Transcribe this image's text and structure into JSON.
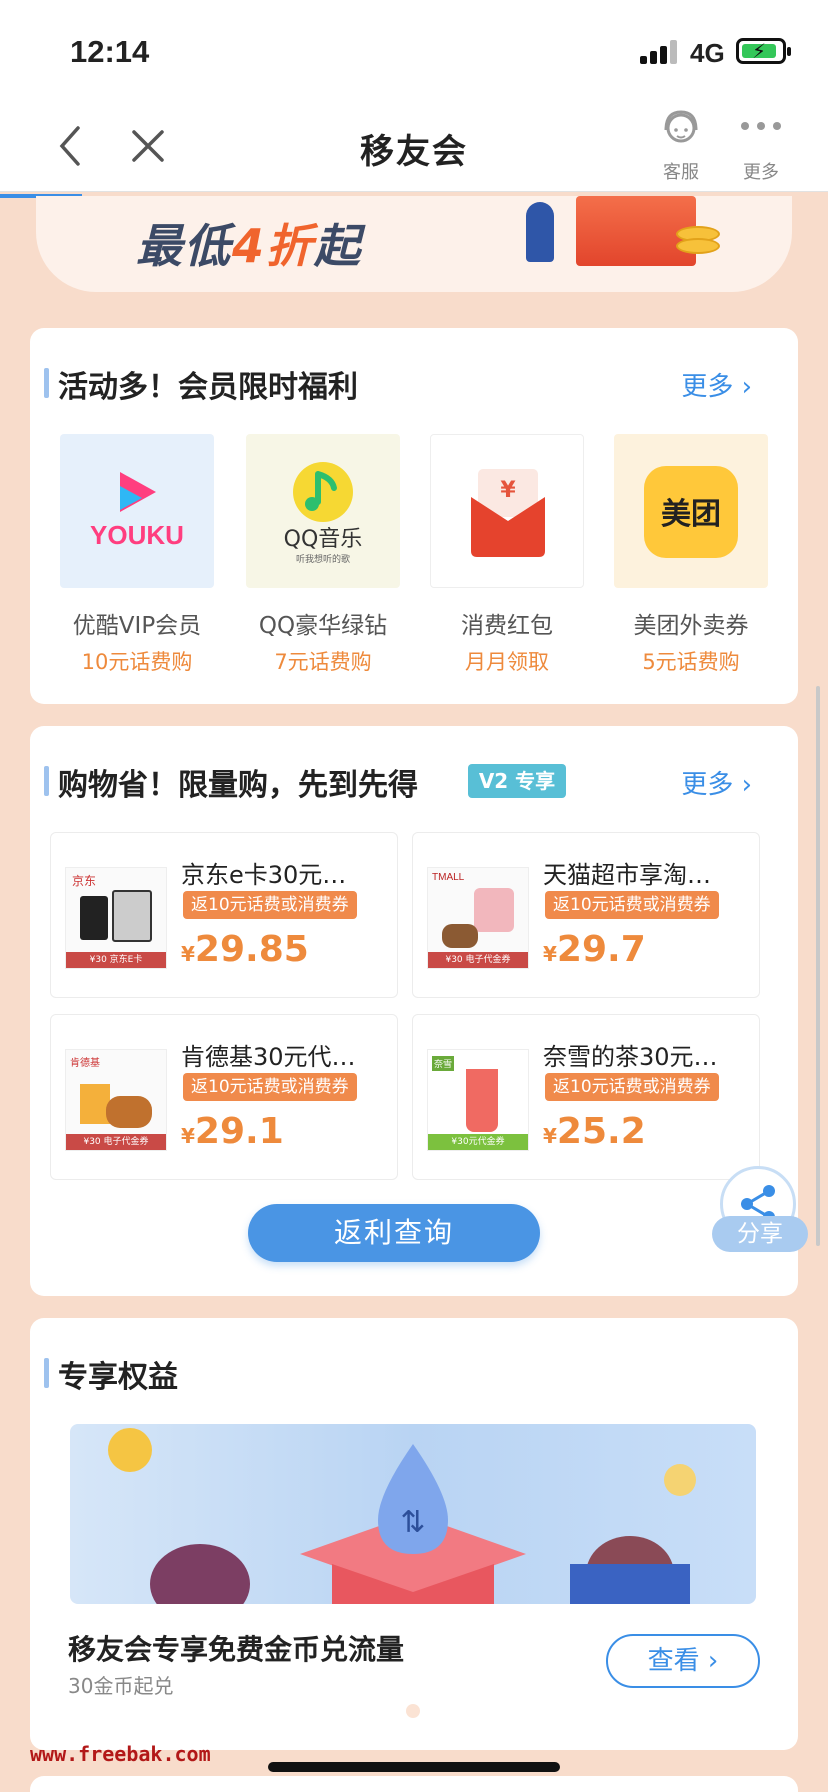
{
  "status_bar": {
    "time": "12:14",
    "network": "4G"
  },
  "nav": {
    "title": "移友会",
    "service_label": "客服",
    "more_label": "更多"
  },
  "banner": {
    "text_prefix": "最低",
    "text_highlight": "4折",
    "text_suffix": "起"
  },
  "benefits_section": {
    "title": "活动多！会员限时福利",
    "more": "更多 ›",
    "items": [
      {
        "logo_text": "YOUKU",
        "name": "优酷VIP会员",
        "sub": "10元话费购"
      },
      {
        "logo_text": "QQ音乐",
        "logo_sub": "听我想听的歌",
        "name": "QQ豪华绿钻",
        "sub": "7元话费购"
      },
      {
        "logo_text": "¥",
        "name": "消费红包",
        "sub": "月月领取"
      },
      {
        "logo_text": "美团",
        "name": "美团外卖券",
        "sub": "5元话费购"
      }
    ]
  },
  "shopping_section": {
    "title": "购物省！限量购，先到先得",
    "badge": "V2 专享",
    "more": "更多 ›",
    "products": [
      {
        "name": "京东e卡30元…",
        "badge": "返10元话费或消费券",
        "currency": "¥",
        "price": "29.85",
        "thumb_brand": "京东",
        "thumb_tag": "¥30 京东E卡"
      },
      {
        "name": "天猫超市享淘…",
        "badge": "返10元话费或消费券",
        "currency": "¥",
        "price": "29.7",
        "thumb_brand": "TMALL",
        "thumb_tag": "¥30 电子代金券"
      },
      {
        "name": "肯德基30元代…",
        "badge": "返10元话费或消费券",
        "currency": "¥",
        "price": "29.1",
        "thumb_brand": "肯德基",
        "thumb_tag": "¥30 电子代金券"
      },
      {
        "name": "奈雪的茶30元…",
        "badge": "返10元话费或消费券",
        "currency": "¥",
        "price": "25.2",
        "thumb_brand": "奈雪",
        "thumb_tag": "¥30元代金券"
      }
    ],
    "rebate_button": "返利查询"
  },
  "share": {
    "label": "分享"
  },
  "exclusive_section": {
    "title": "专享权益",
    "item_title": "移友会专享免费金币兑流量",
    "item_sub": "30金币起兑",
    "view_button": "查看 ›"
  },
  "watermark": "www.freebak.com",
  "colors": {
    "accent_blue": "#3a8ee6",
    "accent_orange": "#ee8a3c",
    "page_bg": "#f8dccb",
    "v2_badge": "#58bfd6"
  }
}
